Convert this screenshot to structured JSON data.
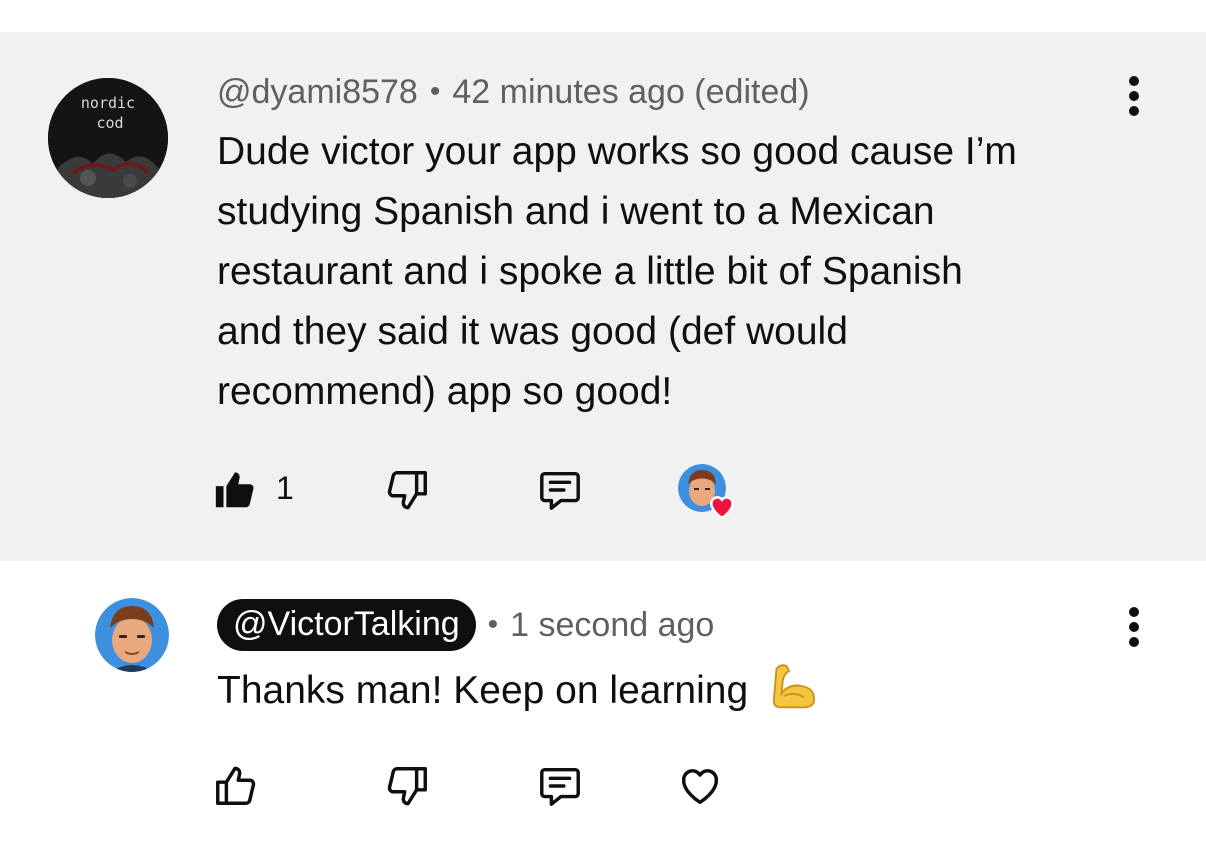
{
  "comments": [
    {
      "author": "@dyami8578",
      "timestamp": "42 minutes ago (edited)",
      "separator": "•",
      "body_lines": [
        "Dude victor your app works so good cause I’m",
        "studying Spanish and i went to a Mexican",
        "restaurant and i spoke a little bit of Spanish",
        "and they said it was good (def would",
        "recommend) app so good!"
      ],
      "like_count": "1",
      "avatar_text": [
        "nordic",
        "cod"
      ],
      "liked": true,
      "hearted_by_creator": true
    },
    {
      "author": "@VictorTalking",
      "timestamp": "1 second ago",
      "separator": "•",
      "body": "Thanks man! Keep on learning",
      "is_creator": true,
      "liked": false
    }
  ],
  "icons": {
    "like": "thumbs-up-icon",
    "dislike": "thumbs-down-icon",
    "reply": "reply-icon",
    "heart": "heart-icon",
    "more": "more-vertical-icon",
    "emoji": "flexed-biceps-emoji"
  },
  "colors": {
    "highlight_bg": "#f1f1f1",
    "text": "#0f0f0f",
    "meta": "#606060",
    "heart_red": "#f0143c",
    "creator_chip": "#0f0f0f"
  }
}
